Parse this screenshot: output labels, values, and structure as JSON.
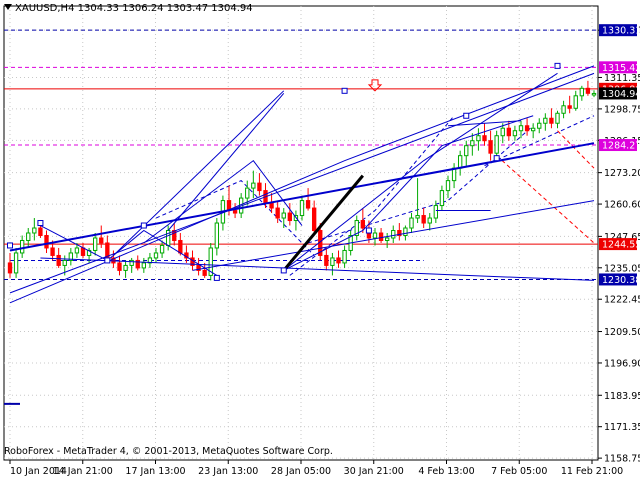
{
  "header": {
    "symbol": "XAUUSD,H4",
    "open": "1304.33",
    "high": "1306.24",
    "low": "1303.47",
    "close": "1304.94"
  },
  "copyright": "RoboForex - MetaTrader 4, © 2001-2013, MetaQuotes Software Corp.",
  "colors": {
    "background": "#ffffff",
    "grid": "#c8c8c8",
    "bull": "#00aa00",
    "bear": "#ff0000",
    "trendline": "#0000cc",
    "level_red": "#ff0000",
    "level_magenta": "#cc00cc",
    "label_blue": "#0000aa",
    "label_red": "#ee0000",
    "label_magenta": "#dd00dd"
  },
  "chart_data": {
    "type": "candlestick",
    "title": "XAUUSD,H4",
    "ylim": [
      1158,
      1340
    ],
    "grid": true,
    "y_ticks": [
      "1330.31",
      "1311.35",
      "1298.75",
      "1286.15",
      "1273.20",
      "1260.60",
      "1247.65",
      "1235.05",
      "1222.45",
      "1209.50",
      "1196.90",
      "1183.95",
      "1171.35",
      "1158.75"
    ],
    "x_ticks": [
      "10 Jan 2014",
      "14 Jan 21:00",
      "17 Jan 13:00",
      "23 Jan 13:00",
      "28 Jan 05:00",
      "30 Jan 21:00",
      "4 Feb 13:00",
      "7 Feb 05:00",
      "11 Feb 21:00"
    ],
    "bar_count": 97,
    "levels": [
      {
        "value": 1330.31,
        "label": "1330.31",
        "style": "dashed",
        "color": "label_blue"
      },
      {
        "value": 1315.42,
        "label": "1315.42",
        "style": "dashed",
        "color": "label_magenta"
      },
      {
        "value": 1306.8,
        "label": "1306.80",
        "style": "solid",
        "color": "label_red"
      },
      {
        "value": 1284.27,
        "label": "1284.27",
        "style": "dashed",
        "color": "label_magenta"
      },
      {
        "value": 1244.55,
        "label": "1244.55",
        "style": "solid",
        "color": "label_red"
      },
      {
        "value": 1230.38,
        "label": "1230.38",
        "style": "dashed",
        "color": "label_blue"
      },
      {
        "value": 1180.5,
        "label": "",
        "style": "solid",
        "color": "label_blue"
      }
    ],
    "close_price": 1304.94,
    "candles": [
      [
        1237,
        1241,
        1231,
        1233
      ],
      [
        1233,
        1243,
        1231,
        1241
      ],
      [
        1241,
        1248,
        1239,
        1246
      ],
      [
        1246,
        1251,
        1243,
        1249
      ],
      [
        1249,
        1255,
        1246,
        1251
      ],
      [
        1251,
        1254,
        1247,
        1248
      ],
      [
        1248,
        1250,
        1241,
        1243
      ],
      [
        1243,
        1246,
        1238,
        1240
      ],
      [
        1240,
        1243,
        1235,
        1236
      ],
      [
        1236,
        1240,
        1232,
        1238
      ],
      [
        1238,
        1243,
        1236,
        1241
      ],
      [
        1241,
        1245,
        1239,
        1243
      ],
      [
        1243,
        1245,
        1239,
        1240
      ],
      [
        1240,
        1243,
        1237,
        1242
      ],
      [
        1242,
        1249,
        1240,
        1247
      ],
      [
        1247,
        1252,
        1243,
        1245
      ],
      [
        1245,
        1248,
        1238,
        1239
      ],
      [
        1239,
        1242,
        1235,
        1237
      ],
      [
        1237,
        1240,
        1232,
        1234
      ],
      [
        1234,
        1238,
        1231,
        1236
      ],
      [
        1236,
        1239,
        1233,
        1238
      ],
      [
        1238,
        1240,
        1234,
        1235
      ],
      [
        1235,
        1239,
        1233,
        1237
      ],
      [
        1237,
        1241,
        1235,
        1239
      ],
      [
        1239,
        1243,
        1237,
        1241
      ],
      [
        1241,
        1246,
        1239,
        1244
      ],
      [
        1244,
        1252,
        1242,
        1250
      ],
      [
        1250,
        1253,
        1244,
        1246
      ],
      [
        1246,
        1249,
        1240,
        1241
      ],
      [
        1241,
        1244,
        1237,
        1239
      ],
      [
        1239,
        1242,
        1234,
        1236
      ],
      [
        1236,
        1239,
        1232,
        1234
      ],
      [
        1234,
        1237,
        1231,
        1232
      ],
      [
        1232,
        1245,
        1230,
        1243
      ],
      [
        1243,
        1255,
        1240,
        1253
      ],
      [
        1253,
        1264,
        1250,
        1262
      ],
      [
        1262,
        1268,
        1256,
        1258
      ],
      [
        1258,
        1261,
        1255,
        1257
      ],
      [
        1257,
        1265,
        1255,
        1263
      ],
      [
        1263,
        1270,
        1260,
        1267
      ],
      [
        1267,
        1274,
        1263,
        1269
      ],
      [
        1269,
        1273,
        1264,
        1266
      ],
      [
        1266,
        1269,
        1259,
        1261
      ],
      [
        1261,
        1265,
        1257,
        1259
      ],
      [
        1259,
        1262,
        1253,
        1255
      ],
      [
        1255,
        1259,
        1251,
        1257
      ],
      [
        1257,
        1261,
        1252,
        1254
      ],
      [
        1254,
        1258,
        1250,
        1256
      ],
      [
        1256,
        1264,
        1254,
        1262
      ],
      [
        1262,
        1267,
        1258,
        1259
      ],
      [
        1259,
        1262,
        1248,
        1250
      ],
      [
        1250,
        1253,
        1238,
        1240
      ],
      [
        1240,
        1243,
        1234,
        1236
      ],
      [
        1236,
        1241,
        1232,
        1239
      ],
      [
        1239,
        1242,
        1235,
        1237
      ],
      [
        1237,
        1244,
        1235,
        1242
      ],
      [
        1242,
        1250,
        1240,
        1248
      ],
      [
        1248,
        1256,
        1246,
        1254
      ],
      [
        1254,
        1259,
        1249,
        1251
      ],
      [
        1251,
        1254,
        1245,
        1247
      ],
      [
        1247,
        1251,
        1244,
        1249
      ],
      [
        1249,
        1251,
        1245,
        1246
      ],
      [
        1246,
        1249,
        1243,
        1247
      ],
      [
        1247,
        1252,
        1245,
        1250
      ],
      [
        1250,
        1253,
        1246,
        1248
      ],
      [
        1248,
        1252,
        1246,
        1251
      ],
      [
        1251,
        1257,
        1249,
        1255
      ],
      [
        1255,
        1271,
        1253,
        1256
      ],
      [
        1256,
        1259,
        1251,
        1253
      ],
      [
        1253,
        1257,
        1250,
        1255
      ],
      [
        1255,
        1262,
        1253,
        1260
      ],
      [
        1260,
        1268,
        1258,
        1266
      ],
      [
        1266,
        1272,
        1263,
        1270
      ],
      [
        1270,
        1277,
        1267,
        1275
      ],
      [
        1275,
        1282,
        1272,
        1280
      ],
      [
        1280,
        1286,
        1276,
        1284
      ],
      [
        1284,
        1289,
        1280,
        1286
      ],
      [
        1286,
        1291,
        1282,
        1288
      ],
      [
        1288,
        1293,
        1284,
        1286
      ],
      [
        1286,
        1290,
        1278,
        1281
      ],
      [
        1281,
        1290,
        1279,
        1288
      ],
      [
        1288,
        1293,
        1285,
        1291
      ],
      [
        1291,
        1294,
        1286,
        1288
      ],
      [
        1288,
        1292,
        1286,
        1290
      ],
      [
        1290,
        1294,
        1287,
        1292
      ],
      [
        1292,
        1295,
        1288,
        1290
      ],
      [
        1290,
        1293,
        1287,
        1291
      ],
      [
        1291,
        1295,
        1289,
        1293
      ],
      [
        1293,
        1297,
        1290,
        1295
      ],
      [
        1295,
        1299,
        1291,
        1293
      ],
      [
        1293,
        1298,
        1291,
        1297
      ],
      [
        1297,
        1302,
        1295,
        1300
      ],
      [
        1300,
        1304,
        1297,
        1299
      ],
      [
        1299,
        1306,
        1298,
        1304
      ],
      [
        1304,
        1308,
        1302,
        1307
      ],
      [
        1307,
        1310,
        1304,
        1305
      ],
      [
        1304.33,
        1306.24,
        1303.47,
        1304.94
      ]
    ],
    "trend_lines": [
      {
        "points": [
          [
            0,
            1225
          ],
          [
            96,
            1313
          ]
        ],
        "width": 1
      },
      {
        "points": [
          [
            0,
            1221
          ],
          [
            55,
            1278
          ],
          [
            96,
            1316
          ]
        ],
        "width": 1
      },
      {
        "points": [
          [
            0,
            1242
          ],
          [
            96,
            1285
          ]
        ],
        "width": 2
      },
      {
        "points": [
          [
            30,
            1234
          ],
          [
            96,
            1262
          ]
        ],
        "width": 1
      },
      {
        "points": [
          [
            5,
            1239
          ],
          [
            75,
            1232
          ],
          [
            96,
            1230
          ]
        ],
        "width": 1
      },
      {
        "points": [
          [
            17,
            1240
          ],
          [
            45,
            1306
          ]
        ],
        "width": 1
      },
      {
        "points": [
          [
            26,
            1250
          ],
          [
            45,
            1305
          ]
        ],
        "width": 1
      },
      {
        "points": [
          [
            22,
            1245
          ],
          [
            40,
            1278
          ],
          [
            48,
            1252
          ]
        ],
        "width": 1
      },
      {
        "points": [
          [
            5,
            1252
          ],
          [
            16,
            1238
          ],
          [
            22,
            1250
          ],
          [
            34,
            1232
          ]
        ],
        "width": 1
      },
      {
        "points": [
          [
            45,
            1234
          ],
          [
            68,
            1278
          ],
          [
            90,
            1313
          ]
        ],
        "width": 1
      },
      {
        "points": [
          [
            45,
            1234
          ],
          [
            58,
            1250
          ],
          [
            71,
            1284
          ],
          [
            86,
            1296
          ]
        ],
        "width": 1
      },
      {
        "points": [
          [
            72,
            1292
          ],
          [
            84,
            1294
          ]
        ],
        "width": 1
      },
      {
        "points": [
          [
            70,
            1258
          ],
          [
            79,
            1258
          ]
        ],
        "width": 1
      }
    ],
    "dashed_lines": [
      {
        "points": [
          [
            0,
            1238
          ],
          [
            45,
            1238
          ],
          [
            68,
            1238
          ]
        ],
        "color": "trendline"
      },
      {
        "points": [
          [
            24,
            1255
          ],
          [
            38,
            1270
          ],
          [
            50,
            1240
          ]
        ],
        "color": "trendline"
      },
      {
        "points": [
          [
            46,
            1232
          ],
          [
            60,
            1258
          ],
          [
            73,
            1296
          ]
        ],
        "color": "trendline"
      },
      {
        "points": [
          [
            49,
            1245
          ],
          [
            72,
            1262
          ],
          [
            86,
            1292
          ]
        ],
        "color": "trendline"
      },
      {
        "points": [
          [
            78,
            1276
          ],
          [
            96,
            1296
          ]
        ],
        "color": "trendline"
      },
      {
        "points": [
          [
            80,
            1280
          ],
          [
            96,
            1245
          ]
        ],
        "color": "level_red"
      },
      {
        "points": [
          [
            90,
            1290
          ],
          [
            96,
            1275
          ]
        ],
        "color": "level_red"
      }
    ],
    "markers": [
      [
        0,
        1244
      ],
      [
        5,
        1253
      ],
      [
        16,
        1238
      ],
      [
        22,
        1252
      ],
      [
        34,
        1231
      ],
      [
        45,
        1234
      ],
      [
        59,
        1250
      ],
      [
        75,
        1296
      ],
      [
        80,
        1279
      ],
      [
        90,
        1316
      ],
      [
        55,
        1306
      ]
    ],
    "bold_arrow": {
      "from": [
        45,
        1234
      ],
      "to": [
        58,
        1272
      ]
    },
    "arrow_marker": {
      "x": 60,
      "y": 1308
    }
  }
}
